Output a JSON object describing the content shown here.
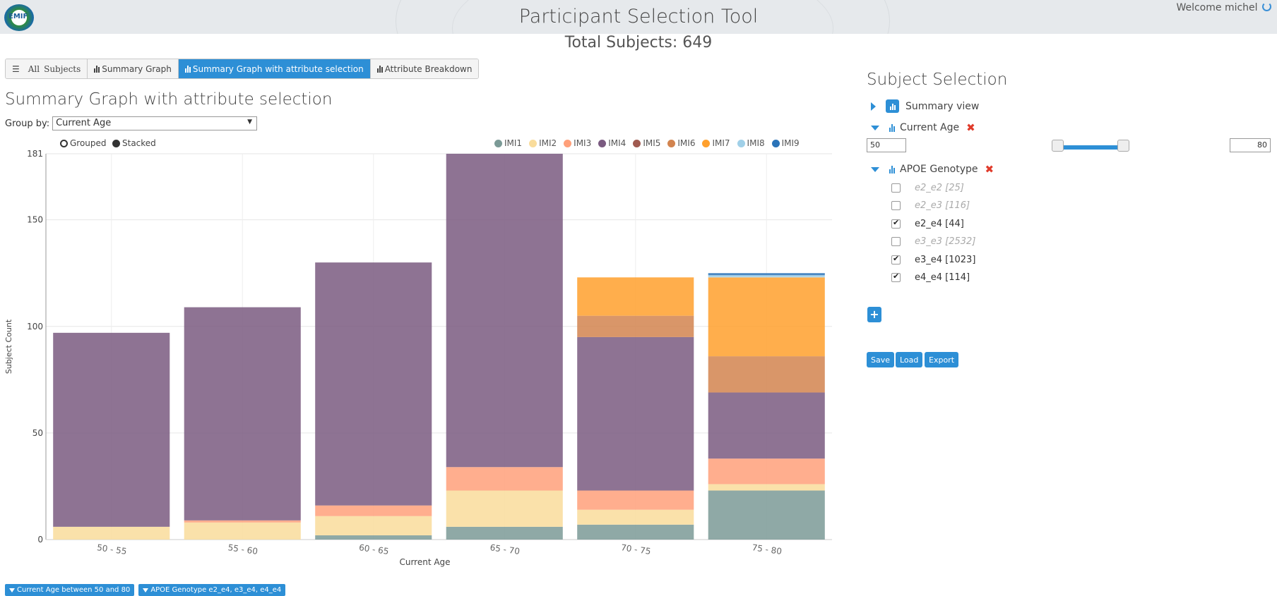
{
  "header": {
    "logo_text": "EMIF",
    "title": "Participant Selection Tool",
    "welcome": "Welcome michel"
  },
  "total_subjects": "Total Subjects: 649",
  "tabs": [
    {
      "label": "All",
      "label2": "Subjects",
      "icon": "list-icon",
      "active": false
    },
    {
      "label": "Summary Graph",
      "icon": "bar-chart-icon",
      "active": false
    },
    {
      "label": "Summary Graph with attribute selection",
      "icon": "bar-chart-icon",
      "active": true
    },
    {
      "label": "Attribute Breakdown",
      "icon": "bar-chart-icon",
      "active": false
    }
  ],
  "section_title": "Summary Graph with attribute selection",
  "group_by": {
    "label": "Group by:",
    "value": "Current Age"
  },
  "modes": {
    "grouped": "Grouped",
    "stacked": "Stacked",
    "selected": "stacked"
  },
  "legend": [
    {
      "name": "IMI1",
      "color": "#7b9a96"
    },
    {
      "name": "IMI2",
      "color": "#f9dc9b"
    },
    {
      "name": "IMI3",
      "color": "#ffa07a"
    },
    {
      "name": "IMI4",
      "color": "#7a5a80"
    },
    {
      "name": "IMI5",
      "color": "#a05a50"
    },
    {
      "name": "IMI6",
      "color": "#d2844f"
    },
    {
      "name": "IMI7",
      "color": "#ffa02d"
    },
    {
      "name": "IMI8",
      "color": "#a0d0e8"
    },
    {
      "name": "IMI9",
      "color": "#2a73b8"
    }
  ],
  "chart_data": {
    "type": "bar",
    "stacked": true,
    "categories": [
      "50 - 55",
      "55 - 60",
      "60 - 65",
      "65 - 70",
      "70 - 75",
      "75 - 80"
    ],
    "xlabel": "Current Age",
    "ylabel": "Subject Count",
    "ylim": [
      0,
      181
    ],
    "yticks": [
      0,
      50,
      100,
      150,
      181
    ],
    "grid": true,
    "legend_position": "top-right",
    "series": [
      {
        "name": "IMI1",
        "values": [
          0,
          0,
          2,
          6,
          7,
          23
        ]
      },
      {
        "name": "IMI2",
        "values": [
          6,
          8,
          9,
          17,
          7,
          3
        ]
      },
      {
        "name": "IMI3",
        "values": [
          0,
          1,
          5,
          11,
          9,
          12
        ]
      },
      {
        "name": "IMI4",
        "values": [
          91,
          100,
          114,
          147,
          72,
          31
        ]
      },
      {
        "name": "IMI5",
        "values": [
          0,
          0,
          0,
          0,
          0,
          0
        ]
      },
      {
        "name": "IMI6",
        "values": [
          0,
          0,
          0,
          0,
          10,
          17
        ]
      },
      {
        "name": "IMI7",
        "values": [
          0,
          0,
          0,
          0,
          18,
          37
        ]
      },
      {
        "name": "IMI8",
        "values": [
          0,
          0,
          0,
          0,
          0,
          1
        ]
      },
      {
        "name": "IMI9",
        "values": [
          0,
          0,
          0,
          0,
          0,
          1
        ]
      }
    ]
  },
  "filters": [
    "Current Age between 50 and 80",
    "APOE Genotype e2_e4, e3_e4, e4_e4"
  ],
  "subject_selection": {
    "title": "Subject Selection",
    "summary_view": "Summary view",
    "current_age": {
      "label": "Current Age",
      "min": "50",
      "max": "80"
    },
    "apoe": {
      "label": "APOE Genotype",
      "options": [
        {
          "label": "e2_e2 [25]",
          "checked": false,
          "disabled": true
        },
        {
          "label": "e2_e3 [116]",
          "checked": false,
          "disabled": true
        },
        {
          "label": "e2_e4 [44]",
          "checked": true,
          "disabled": false
        },
        {
          "label": "e3_e3 [2532]",
          "checked": false,
          "disabled": true
        },
        {
          "label": "e3_e4 [1023]",
          "checked": true,
          "disabled": false
        },
        {
          "label": "e4_e4 [114]",
          "checked": true,
          "disabled": false
        }
      ]
    },
    "add_label": "+",
    "buttons": {
      "save": "Save",
      "load": "Load",
      "export": "Export"
    }
  }
}
